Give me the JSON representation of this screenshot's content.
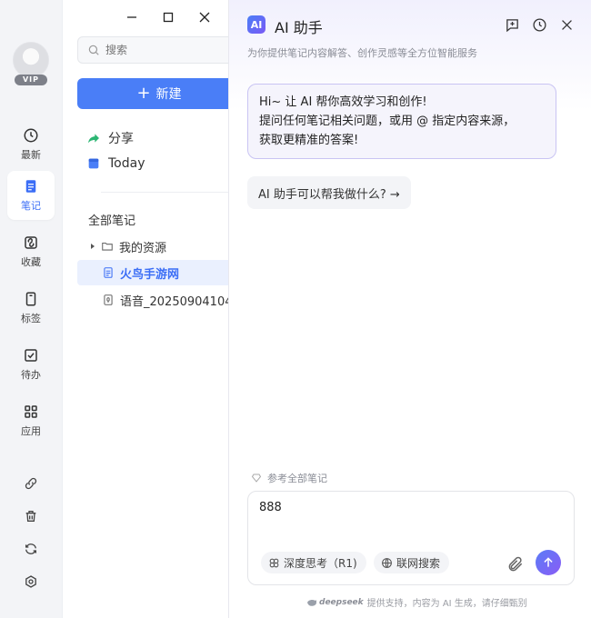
{
  "window": {
    "minimize": "minimize",
    "maximize": "maximize",
    "close": "close"
  },
  "user": {
    "badge": "VIP"
  },
  "rail": {
    "items": [
      {
        "label": "最新",
        "icon": "clock-icon"
      },
      {
        "label": "笔记",
        "icon": "note-icon",
        "active": true
      },
      {
        "label": "收藏",
        "icon": "bookmark-icon"
      },
      {
        "label": "标签",
        "icon": "tag-icon"
      },
      {
        "label": "待办",
        "icon": "checkbox-icon"
      },
      {
        "label": "应用",
        "icon": "apps-icon"
      }
    ],
    "tools": [
      "link-icon",
      "trash-icon",
      "sync-icon",
      "settings-icon"
    ]
  },
  "notes": {
    "search_placeholder": "搜索",
    "new_label": "新建",
    "nav": [
      {
        "label": "分享",
        "icon": "share-icon"
      },
      {
        "label": "Today",
        "icon": "calendar-icon"
      }
    ],
    "section": "全部笔记",
    "tree": [
      {
        "label": "我的资源",
        "type": "folder"
      },
      {
        "label": "火鸟手游网",
        "type": "doc",
        "selected": true
      },
      {
        "label": "语音_20250904104",
        "type": "audio"
      }
    ]
  },
  "ai": {
    "logo": "AI",
    "title": "AI 助手",
    "subtitle": "为你提供笔记内容解答、创作灵感等全方位智能服务",
    "greeting": [
      "Hi~ 让 AI 帮你高效学习和创作!",
      "提问任何笔记相关问题，或用 @ 指定内容来源，",
      "获取更精准的答案!"
    ],
    "suggestion": "AI 助手可以帮我做什么? →",
    "reference": "参考全部笔记",
    "input_value": "888",
    "chip_deep": "深度思考（R1)",
    "chip_web": "联网搜索",
    "footer_brand": "deepseek",
    "footer_text": "提供支持，内容为 AI 生成，请仔细甄别"
  },
  "colors": {
    "accent": "#4a7ef7",
    "ai_gradient_end": "#8a5cf5",
    "share_green": "#2bb673"
  }
}
